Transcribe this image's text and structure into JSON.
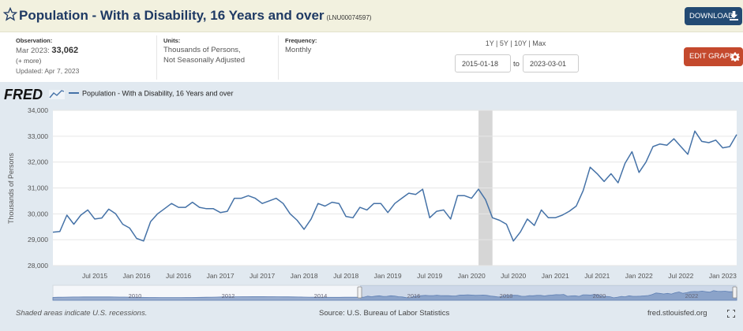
{
  "header": {
    "title": "Population - With a Disability, 16 Years and over",
    "series_id": "(LNU00074597)",
    "download_label": "DOWNLOAD",
    "bg_color": "#f2f1df"
  },
  "info": {
    "observation_label": "Observation:",
    "observation_date": "Mar 2023:",
    "observation_value": "33,062",
    "more": "(+ more)",
    "updated": "Updated: Apr 7, 2023",
    "units_label": "Units:",
    "units_line1": "Thousands of Persons,",
    "units_line2": "Not Seasonally Adjusted",
    "frequency_label": "Frequency:",
    "frequency_value": "Monthly"
  },
  "controls": {
    "range_1y": "1Y",
    "range_5y": "5Y",
    "range_10y": "10Y",
    "range_max": "Max",
    "date_from": "2015-01-18",
    "to_label": "to",
    "date_to": "2023-03-01",
    "edit_label": "EDIT GRAPH",
    "edit_color": "#c4492d"
  },
  "brand": {
    "logo_text": "FRED"
  },
  "chart_data": {
    "type": "line",
    "legend": "Population - With a Disability, 16 Years and over",
    "ylabel": "Thousands of Persons",
    "ylim": [
      28000,
      34000
    ],
    "yticks": [
      28000,
      29000,
      30000,
      31000,
      32000,
      33000,
      34000
    ],
    "ytick_labels": [
      "28,000",
      "29,000",
      "30,000",
      "31,000",
      "32,000",
      "33,000",
      "34,000"
    ],
    "x_start": "2015-01",
    "xtick_labels": [
      "Jul 2015",
      "Jan 2016",
      "Jul 2016",
      "Jan 2017",
      "Jul 2017",
      "Jan 2018",
      "Jul 2018",
      "Jan 2019",
      "Jul 2019",
      "Jan 2020",
      "Jul 2020",
      "Jan 2021",
      "Jul 2021",
      "Jan 2022",
      "Jul 2022",
      "Jan 2023"
    ],
    "xtick_months": [
      6,
      12,
      18,
      24,
      30,
      36,
      42,
      48,
      54,
      60,
      66,
      72,
      78,
      84,
      90,
      96
    ],
    "recession": {
      "start_month": 61,
      "end_month": 63
    },
    "grid": true,
    "line_color": "#4572a7",
    "values": [
      29290,
      29320,
      29950,
      29600,
      29950,
      30150,
      29800,
      29840,
      30180,
      30000,
      29600,
      29450,
      29050,
      28950,
      29700,
      30000,
      30200,
      30400,
      30250,
      30250,
      30450,
      30250,
      30200,
      30200,
      30050,
      30100,
      30600,
      30600,
      30700,
      30600,
      30400,
      30500,
      30600,
      30400,
      30000,
      29750,
      29400,
      29800,
      30400,
      30300,
      30450,
      30400,
      29900,
      29850,
      30250,
      30150,
      30400,
      30400,
      30050,
      30400,
      30600,
      30800,
      30750,
      30950,
      29850,
      30100,
      30150,
      29800,
      30700,
      30700,
      30600,
      30950,
      30550,
      29850,
      29750,
      29600,
      28950,
      29300,
      29800,
      29550,
      30150,
      29850,
      29850,
      29950,
      30100,
      30300,
      30900,
      31800,
      31550,
      31250,
      31550,
      31200,
      31950,
      32400,
      31600,
      32000,
      32600,
      32700,
      32650,
      32900,
      32600,
      32300,
      33200,
      32800,
      32750,
      32850,
      32550,
      32600,
      33062
    ]
  },
  "navigator": {
    "year_labels": [
      "2010",
      "2012",
      "2014",
      "2016",
      "2018",
      "2020",
      "2022"
    ]
  },
  "footer": {
    "recession_note": "Shaded areas indicate U.S. recessions.",
    "source": "Source: U.S. Bureau of Labor Statistics",
    "site": "fred.stlouisfed.org"
  }
}
